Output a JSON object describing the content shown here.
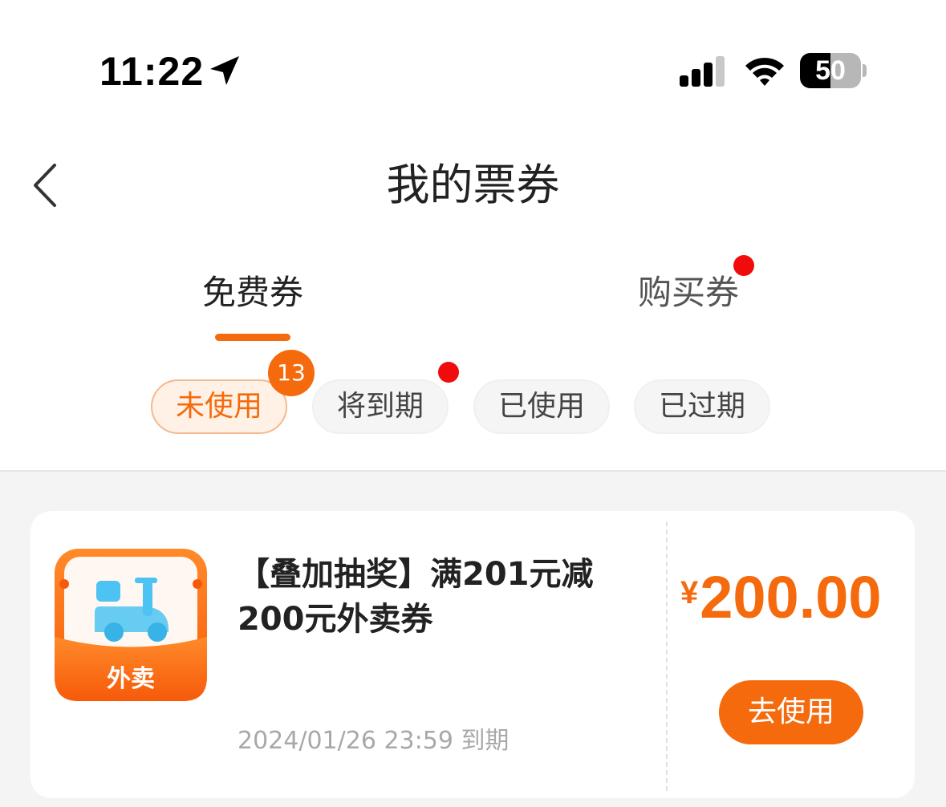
{
  "status_bar": {
    "time": "11:22",
    "battery_level": "50",
    "icons": [
      "location-arrow-icon",
      "signal-icon",
      "wifi-icon",
      "battery-icon"
    ]
  },
  "nav": {
    "title": "我的票券",
    "back_icon": "chevron-left-icon"
  },
  "tabs": [
    {
      "label": "免费券",
      "active": true
    },
    {
      "label": "购买券",
      "active": false,
      "has_dot": true
    }
  ],
  "filters": [
    {
      "label": "未使用",
      "active": true,
      "count": "13"
    },
    {
      "label": "将到期",
      "active": false,
      "has_dot": true
    },
    {
      "label": "已使用",
      "active": false
    },
    {
      "label": "已过期",
      "active": false
    }
  ],
  "coupons": [
    {
      "icon": "takeout-scooter-icon",
      "icon_label": "外卖",
      "title": "【叠加抽奖】满201元减200元外卖券",
      "currency": "¥",
      "amount": "200.00",
      "expiry": "2024/01/26 23:59 到期",
      "action_label": "去使用"
    }
  ],
  "colors": {
    "accent": "#f56a0c",
    "dot_red": "#f00c0c",
    "list_bg": "#f4f4f4",
    "chip_active_bg": "#fff1e6",
    "icon_blue": "#4cc3f2"
  }
}
